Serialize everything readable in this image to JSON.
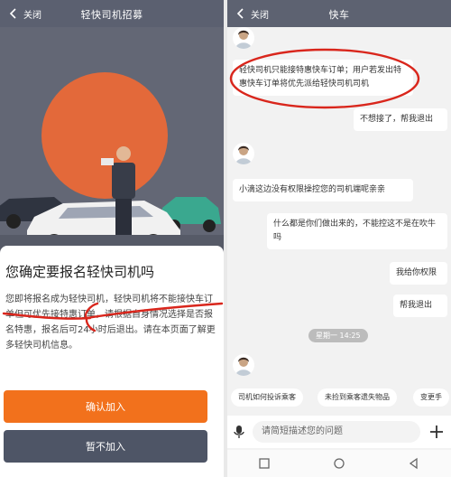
{
  "left": {
    "nav": {
      "close_label": "关闭",
      "title": "轻快司机招募"
    },
    "modal": {
      "heading": "您确定要报名轻快司机吗",
      "body": "您即将报名成为轻快司机，轻快司机将不能接快车订单但可优先接特惠订单，请根据自身情况选择是否报名特惠，报名后可24小时后退出。请在本页面了解更多轻快司机信息。",
      "confirm_label": "确认加入",
      "decline_label": "暂不加入"
    },
    "colors": {
      "confirm": "#f2711c",
      "decline": "#4e5566",
      "annotation": "#d9261c"
    }
  },
  "right": {
    "nav": {
      "close_label": "关闭",
      "title": "快车"
    },
    "messages": [
      {
        "side": "in",
        "text": "轻快司机只能接特惠快车订单；用户若发出特惠快车订单将优先派给轻快司机司机"
      },
      {
        "side": "out",
        "text": "不想接了，帮我退出"
      },
      {
        "side": "in",
        "text": "小滴这边没有权限操控您的司机端呢亲亲"
      },
      {
        "side": "out",
        "text": "什么都是你们做出来的，不能控这不是在吹牛吗"
      },
      {
        "side": "out",
        "text": "我给你权限"
      },
      {
        "side": "out",
        "text": "帮我退出"
      }
    ],
    "time_chip": "星期一 14:25",
    "quick_chips": [
      "司机如何投诉乘客",
      "未捡到乘客遗失物品",
      "变更手"
    ],
    "input_placeholder": "请简短描述您的问题"
  }
}
